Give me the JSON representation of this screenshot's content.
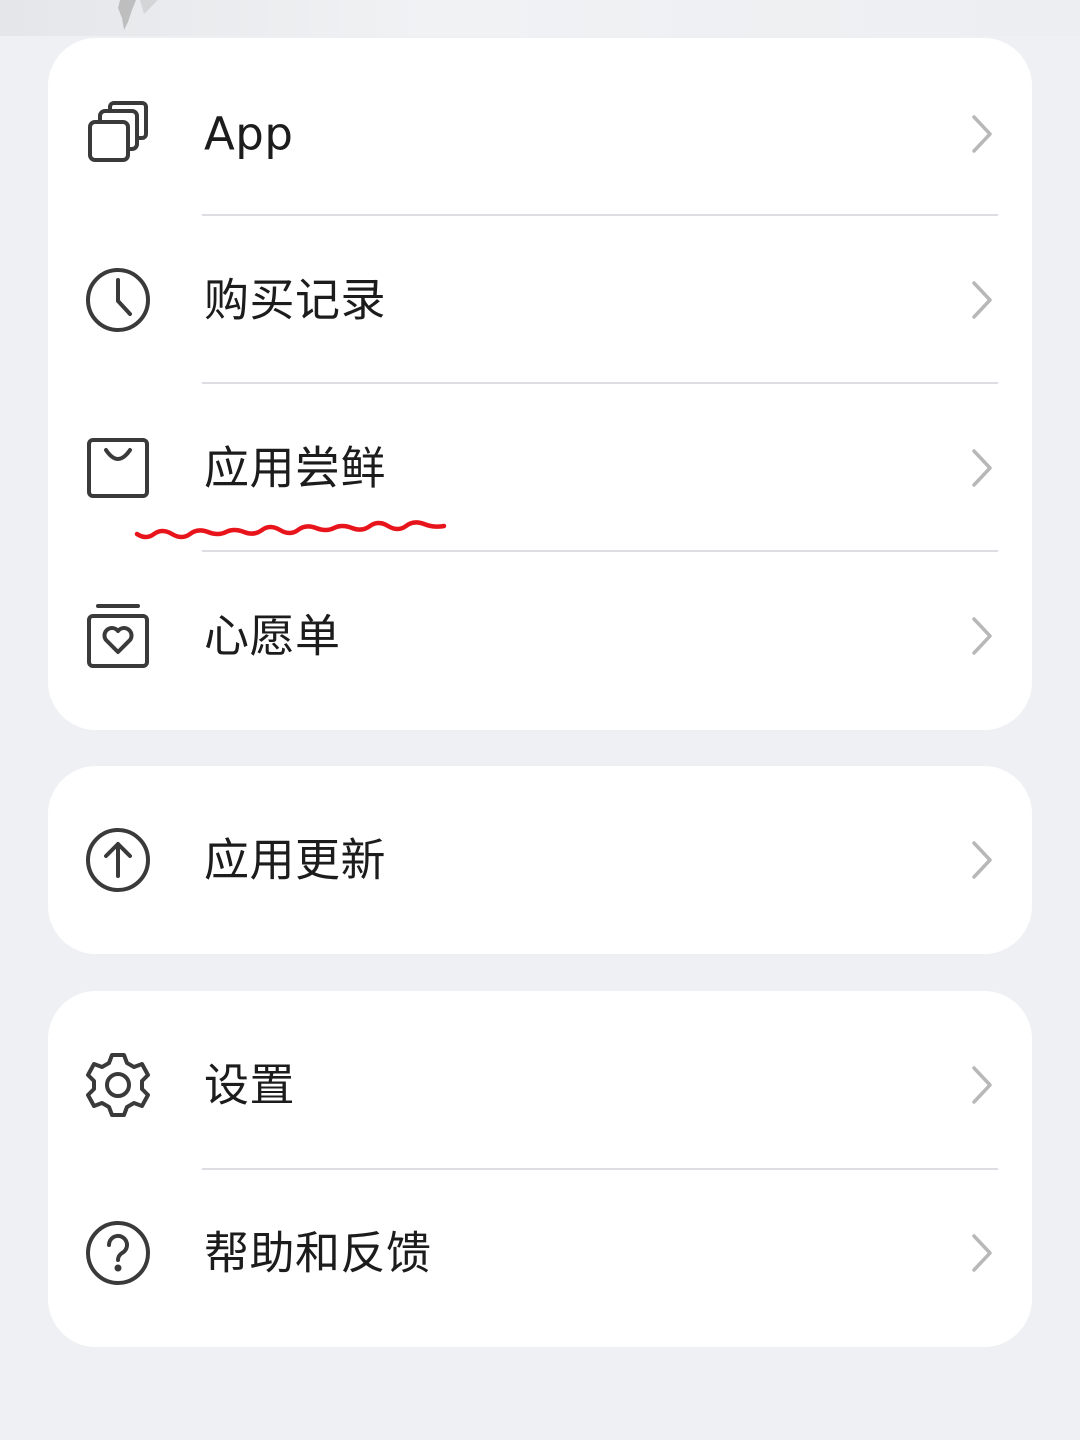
{
  "menu_group_1": {
    "items": [
      {
        "label": "App",
        "icon": "app-stack-icon"
      },
      {
        "label": "购买记录",
        "icon": "clock-icon"
      },
      {
        "label": "应用尝鲜",
        "icon": "shopping-bag-icon"
      },
      {
        "label": "心愿单",
        "icon": "wishlist-heart-icon"
      }
    ]
  },
  "menu_group_2": {
    "items": [
      {
        "label": "应用更新",
        "icon": "arrow-up-circle-icon"
      }
    ]
  },
  "menu_group_3": {
    "items": [
      {
        "label": "设置",
        "icon": "gear-icon"
      },
      {
        "label": "帮助和反馈",
        "icon": "help-question-icon"
      }
    ]
  },
  "colors": {
    "page_background": "#eef0f3",
    "card_background": "#ffffff",
    "text": "#1c1c1c",
    "icon_stroke": "#3a3a3a",
    "chevron": "#b8b8b8",
    "divider": "#dcdee2",
    "annotation_underline": "#e8141b"
  }
}
